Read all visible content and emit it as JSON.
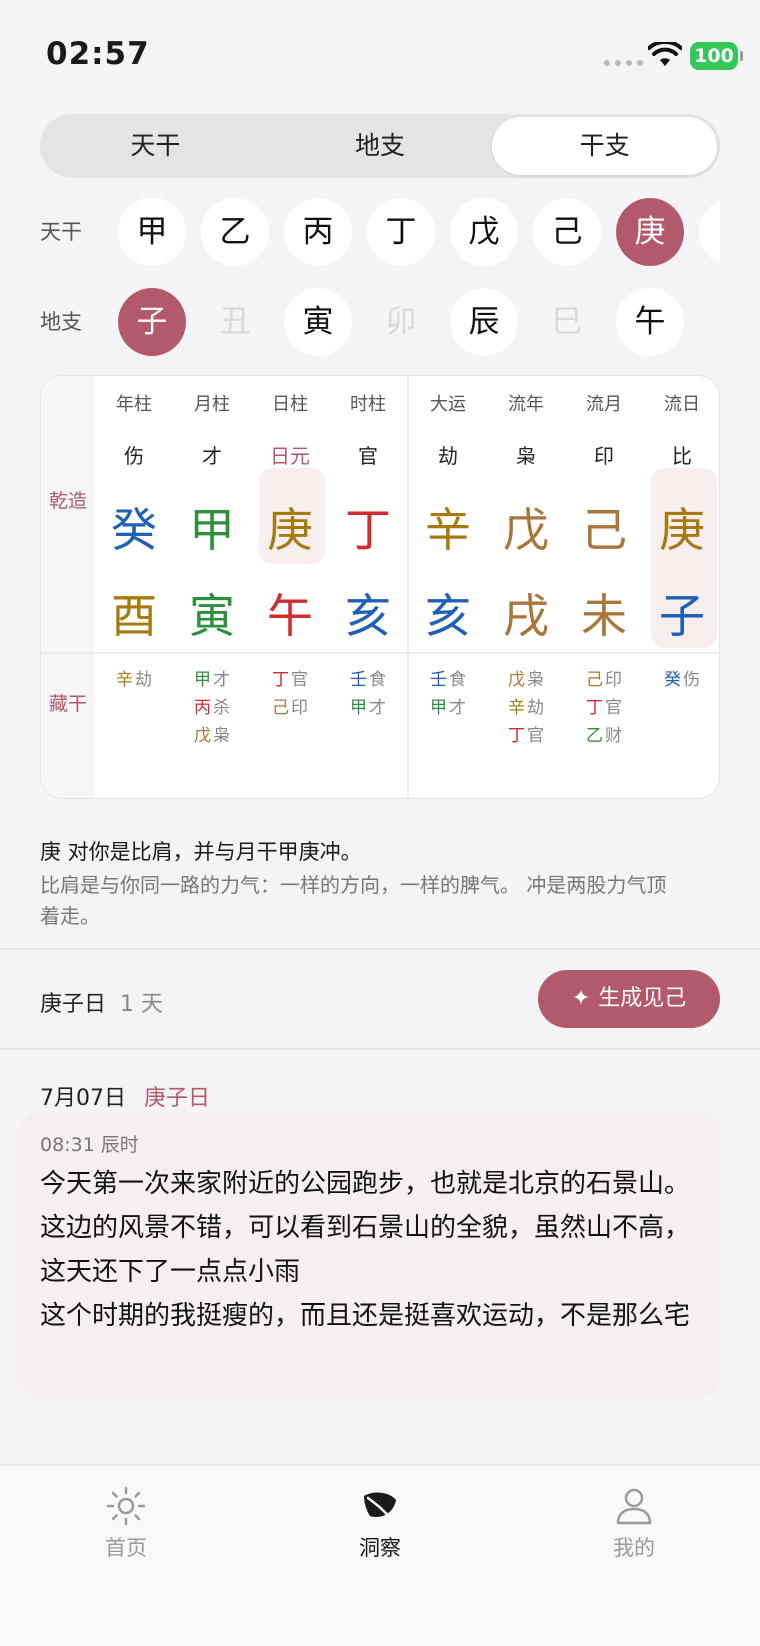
{
  "status": {
    "time": "02:57",
    "battery": "100"
  },
  "segmented": {
    "items": [
      "天干",
      "地支",
      "干支"
    ],
    "active": 2
  },
  "pickers": {
    "tiangan_label": "天干",
    "tiangan": [
      "甲",
      "乙",
      "丙",
      "丁",
      "戊",
      "己",
      "庚"
    ],
    "dizhi_label": "地支",
    "dizhi": [
      "子",
      "丑",
      "寅",
      "卯",
      "辰",
      "巳",
      "午"
    ]
  },
  "chart": {
    "side_top": "乾造",
    "side_bottom": "藏干",
    "columns": [
      {
        "title": "年柱",
        "ten": "伤",
        "gan": "癸",
        "zhi": "酉",
        "hidden": [
          {
            "g": "辛",
            "t": "劫"
          }
        ]
      },
      {
        "title": "月柱",
        "ten": "才",
        "gan": "甲",
        "zhi": "寅",
        "hidden": [
          {
            "g": "甲",
            "t": "才"
          },
          {
            "g": "丙",
            "t": "杀"
          },
          {
            "g": "戊",
            "t": "枭"
          }
        ]
      },
      {
        "title": "日柱",
        "ten": "日元",
        "gan": "庚",
        "zhi": "午",
        "hidden": [
          {
            "g": "丁",
            "t": "官"
          },
          {
            "g": "己",
            "t": "印"
          }
        ]
      },
      {
        "title": "时柱",
        "ten": "官",
        "gan": "丁",
        "zhi": "亥",
        "hidden": [
          {
            "g": "壬",
            "t": "食"
          },
          {
            "g": "甲",
            "t": "才"
          }
        ]
      },
      {
        "title": "大运",
        "ten": "劫",
        "gan": "辛",
        "zhi": "亥",
        "hidden": [
          {
            "g": "壬",
            "t": "食"
          },
          {
            "g": "甲",
            "t": "才"
          }
        ]
      },
      {
        "title": "流年",
        "ten": "枭",
        "gan": "戊",
        "zhi": "戌",
        "hidden": [
          {
            "g": "戊",
            "t": "枭"
          },
          {
            "g": "辛",
            "t": "劫"
          },
          {
            "g": "丁",
            "t": "官"
          }
        ]
      },
      {
        "title": "流月",
        "ten": "印",
        "gan": "己",
        "zhi": "未",
        "hidden": [
          {
            "g": "己",
            "t": "印"
          },
          {
            "g": "丁",
            "t": "官"
          },
          {
            "g": "乙",
            "t": "财"
          }
        ]
      },
      {
        "title": "流日",
        "ten": "比",
        "gan": "庚",
        "zhi": "子",
        "hidden": [
          {
            "g": "癸",
            "t": "伤"
          }
        ]
      }
    ]
  },
  "explanation": {
    "headline": "庚 对你是比肩，并与月干甲庚冲。",
    "detail": "比肩是与你同一路的力气：一样的方向，一样的脾气。 冲是两股力气顶着走。"
  },
  "day": {
    "label": "庚子日",
    "count": "1 天",
    "button": "生成见己"
  },
  "entry": {
    "date": "7月07日",
    "ganzhi": "庚子日",
    "time": "08:31 辰时",
    "text": "今天第一次来家附近的公园跑步，也就是北京的石景山。这边的风景不错，可以看到石景山的全貌，虽然山不高，这天还下了一点点小雨\n这个时期的我挺瘦的，而且还是挺喜欢运动，不是那么宅"
  },
  "tabbar": {
    "items": [
      "首页",
      "洞察",
      "我的"
    ],
    "active": 1
  },
  "colors": {
    "accent": "#b25a6b",
    "wood": "#2e8f3c",
    "fire": "#d12b2b",
    "earth": "#a9753a",
    "metal": "#a77a10",
    "water": "#1f5fb5"
  }
}
